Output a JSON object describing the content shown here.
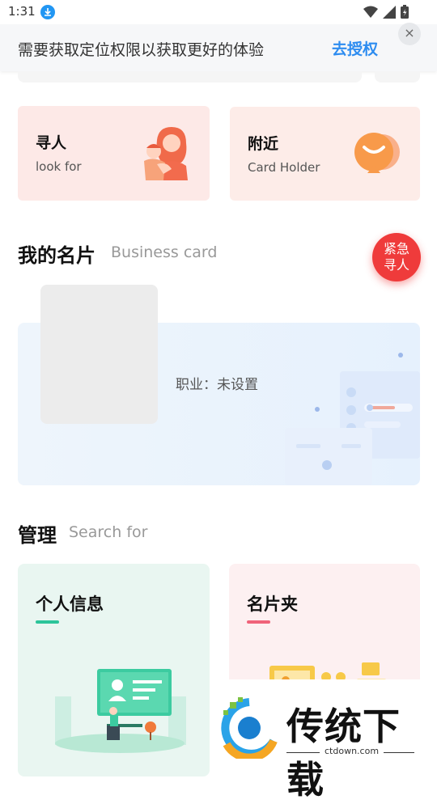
{
  "status_bar": {
    "time": "1:31"
  },
  "banner": {
    "message": "需要获取定位权限以获取更好的体验",
    "authorize_label": "去授权",
    "close_symbol": "×"
  },
  "quick_cards": [
    {
      "title": "寻人",
      "subtitle": "look for",
      "bg": "#fde9e7"
    },
    {
      "title": "附近",
      "subtitle": "Card Holder",
      "bg": "#fdece8"
    }
  ],
  "business_card_section": {
    "title": "我的名片",
    "subtitle": "Business card",
    "job_text": "职业：未设置"
  },
  "sos_button": {
    "line1": "紧急",
    "line2": "寻人"
  },
  "manage_section": {
    "title": "管理",
    "subtitle": "Search for"
  },
  "manage_cards": [
    {
      "title": "个人信息",
      "accent": "#2cc49a",
      "bg": "#e9f6f1"
    },
    {
      "title": "名片夹",
      "accent": "#f0637a",
      "bg": "#fdf0f1"
    }
  ],
  "watermark": {
    "brand": "传统下载",
    "url": "ctdown.com"
  }
}
